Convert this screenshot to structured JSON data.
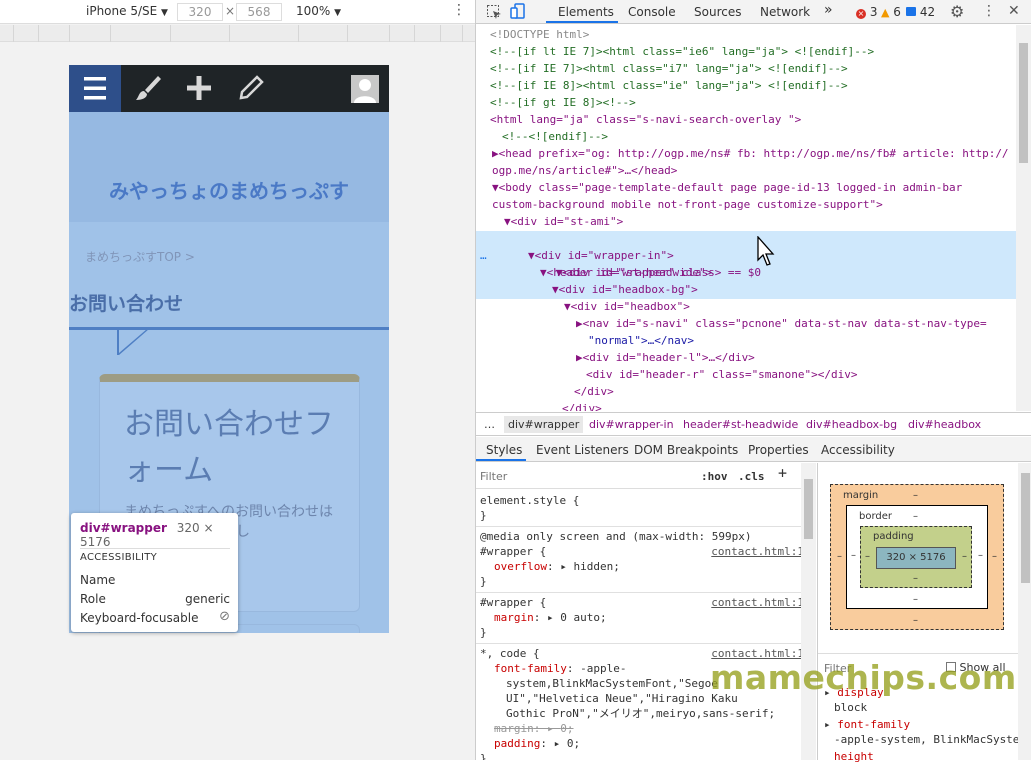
{
  "device_toolbar": {
    "device": "iPhone 5/SE",
    "width": "320",
    "times": "×",
    "height": "568",
    "zoom": "100%"
  },
  "phone": {
    "site_title": "みやっちょのまめちっぷす",
    "breadcrumb": "まめちっぷすTOP >",
    "page_heading": "お問い合わせ",
    "card_title": "お問い合わせフォーム",
    "card_text": "まめちっぷすへのお問い合わせはこちらからお願いし"
  },
  "inspect_tooltip": {
    "element": "div#wrapper",
    "size": "320 × 5176",
    "section": "ACCESSIBILITY",
    "rows": [
      {
        "label": "Name",
        "value": ""
      },
      {
        "label": "Role",
        "value": "generic"
      },
      {
        "label": "Keyboard-focusable",
        "value": ""
      }
    ]
  },
  "devtools": {
    "tabs": [
      "Elements",
      "Console",
      "Sources",
      "Network"
    ],
    "more": "»",
    "errors": "3",
    "warnings": "6",
    "messages": "42",
    "colors": {
      "error": "#d93025",
      "warning": "#f29900",
      "info": "#1a73e8",
      "accent": "#1a73e8"
    },
    "dom_lines": [
      "<!DOCTYPE html>",
      "<!--[if lt IE 7]><html class=\"ie6\" lang=\"ja\"> <![endif]-->",
      "<!--[if IE 7]><html class=\"i7\" lang=\"ja\"> <![endif]-->",
      "<!--[if IE 8]><html class=\"ie\" lang=\"ja\"> <![endif]-->",
      "<!--[if gt IE 8]><!-->",
      "<html lang=\"ja\" class=\"s-navi-search-overlay \">",
      "<!--<![endif]-->",
      "▶<head prefix=\"og: http://ogp.me/ns# fb: http://ogp.me/ns/fb# article: http://",
      "ogp.me/ns/article#\">…</head>",
      "▼<body class=\"page-template-default page page-id-13 logged-in admin-bar",
      "custom-background mobile not-front-page customize-support\">",
      "▼<div id=\"st-ami\">",
      "▼<div id=\"wrapper\" class> == $0",
      "▼<div id=\"wrapper-in\">",
      "▼<header id=\"st-headwide\">",
      "▼<div id=\"headbox-bg\">",
      "▼<div id=\"headbox\">",
      "▶<nav id=\"s-navi\" class=\"pcnone\" data-st-nav data-st-nav-type=",
      "\"normal\">…</nav>",
      "▶<div id=\"header-l\">…</div>",
      "<div id=\"header-r\" class=\"smanone\"></div>",
      "</div>",
      "</div>"
    ],
    "selected_dots": "…",
    "breadcrumbs": [
      "…",
      "div#wrapper",
      "div#wrapper-in",
      "header#st-headwide",
      "div#headbox-bg",
      "div#headbox"
    ],
    "sub_tabs": [
      "Styles",
      "Event Listeners",
      "DOM Breakpoints",
      "Properties",
      "Accessibility"
    ],
    "filter_placeholder": "Filter",
    "hov": ":hov",
    "cls": ".cls",
    "plus": "+",
    "styles": {
      "element_style": "element.style {",
      "close": "}",
      "media": "@media only screen and (max-width: 599px)",
      "rule1_selector": "#wrapper {",
      "rule1_prop": "overflow",
      "rule1_val": "hidden;",
      "rule2_selector": "#wrapper {",
      "rule2_prop": "margin",
      "rule2_val": "0 auto;",
      "rule3_selector": "*, code {",
      "rule3_prop": "font-family",
      "rule3_val_lines": [
        "-apple-",
        "system,BlinkMacSystemFont,\"Segoe",
        "UI\",\"Helvetica Neue\",\"Hiragino Kaku",
        "Gothic ProN\",\"メイリオ\",meiryo,sans-serif;"
      ],
      "rule3_margin": "margin",
      "rule3_margin_val": "0;",
      "rule3_padding": "padding",
      "rule3_padding_val": "0;",
      "source": "contact.html:1"
    },
    "box_model": {
      "margin": "margin",
      "border": "border",
      "padding": "padding",
      "content": "320 × 5176",
      "dash": "–"
    },
    "computed": {
      "filter_placeholder": "Filter",
      "show_all": "Show all",
      "rows": [
        {
          "prop": "display",
          "val": "block"
        },
        {
          "prop": "font-family",
          "val": "-apple-system, BlinkMacSyste"
        },
        {
          "prop": "height",
          "val": ""
        }
      ]
    }
  },
  "watermark": "mamechips.com"
}
